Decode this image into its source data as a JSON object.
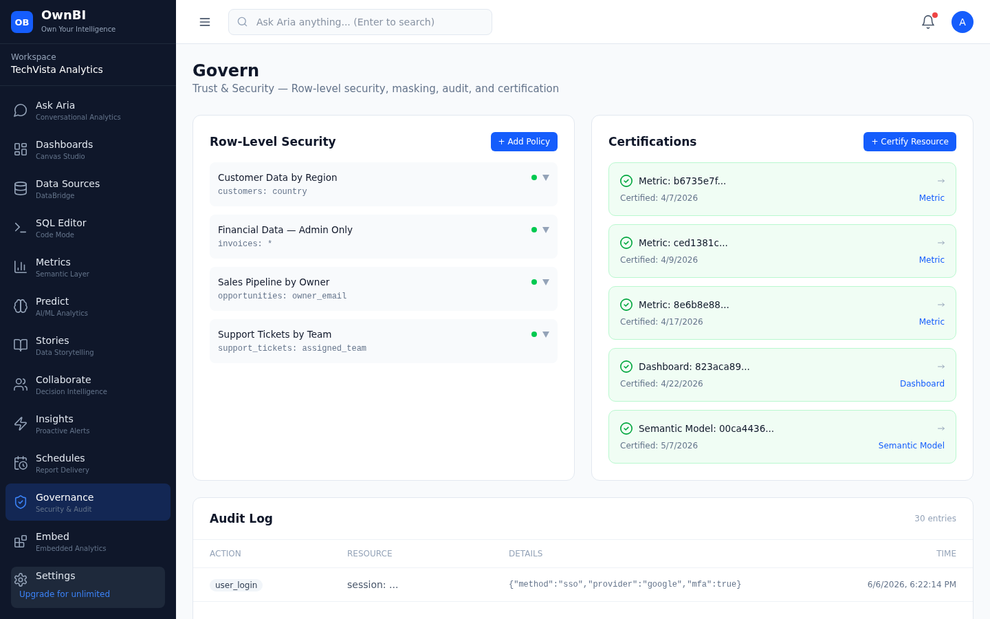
{
  "sidebar": {
    "brand": {
      "mark": "OB",
      "name": "OwnBI",
      "tagline": "Own Your Intelligence"
    },
    "workspace": {
      "label": "Workspace",
      "name": "TechVista Analytics"
    },
    "nav": [
      {
        "title": "Ask Aria",
        "subtitle": "Conversational Analytics",
        "selected": false
      },
      {
        "title": "Dashboards",
        "subtitle": "Canvas Studio",
        "selected": false
      },
      {
        "title": "Data Sources",
        "subtitle": "DataBridge",
        "selected": false
      },
      {
        "title": "SQL Editor",
        "subtitle": "Code Mode",
        "selected": false
      },
      {
        "title": "Metrics",
        "subtitle": "Semantic Layer",
        "selected": false
      },
      {
        "title": "Predict",
        "subtitle": "AI/ML Analytics",
        "selected": false
      },
      {
        "title": "Stories",
        "subtitle": "Data Storytelling",
        "selected": false
      },
      {
        "title": "Collaborate",
        "subtitle": "Decision Intelligence",
        "selected": false
      },
      {
        "title": "Insights",
        "subtitle": "Proactive Alerts",
        "selected": false
      },
      {
        "title": "Schedules",
        "subtitle": "Report Delivery",
        "selected": false
      },
      {
        "title": "Governance",
        "subtitle": "Security & Audit",
        "selected": true
      },
      {
        "title": "Embed",
        "subtitle": "Embedded Analytics",
        "selected": false
      }
    ],
    "footer": {
      "settings": {
        "title": "Settings",
        "selected": false
      },
      "upgrade_link": "Upgrade for unlimited"
    }
  },
  "topbar": {
    "search": {
      "placeholder": "Ask Aria anything... (Enter to search)"
    },
    "notifications": {
      "unread": true
    },
    "avatar": {
      "initial": "A"
    }
  },
  "page": {
    "title": "Govern",
    "subtitle": "Trust & Security — Row-level security, masking, audit, and certification"
  },
  "row_level_security": {
    "title": "Row-Level Security",
    "button": "+ Add Policy",
    "policies": [
      {
        "name": "Customer Data by Region",
        "rule": "customers: country",
        "enabled": true
      },
      {
        "name": "Financial Data — Admin Only",
        "rule": "invoices: *",
        "enabled": true
      },
      {
        "name": "Sales Pipeline by Owner",
        "rule": "opportunities: owner_email",
        "enabled": true
      },
      {
        "name": "Support Tickets by Team",
        "rule": "support_tickets: assigned_team",
        "enabled": true
      }
    ]
  },
  "certifications": {
    "title": "Certifications",
    "button": "+ Certify Resource",
    "items": [
      {
        "name": "Metric: b6735e7f...",
        "certified": "Certified: 4/7/2026",
        "type": "Metric"
      },
      {
        "name": "Metric: ced1381c...",
        "certified": "Certified: 4/9/2026",
        "type": "Metric"
      },
      {
        "name": "Metric: 8e6b8e88...",
        "certified": "Certified: 4/17/2026",
        "type": "Metric"
      },
      {
        "name": "Dashboard: 823aca89...",
        "certified": "Certified: 4/22/2026",
        "type": "Dashboard"
      },
      {
        "name": "Semantic Model: 00ca4436...",
        "certified": "Certified: 5/7/2026",
        "type": "Semantic Model"
      }
    ]
  },
  "audit_log": {
    "title": "Audit Log",
    "count": "30 entries",
    "columns": [
      "ACTION",
      "RESOURCE",
      "DETAILS",
      "TIME"
    ],
    "rows": [
      {
        "action": "user_login",
        "resource": "session: ...",
        "details": "{\"method\":\"sso\",\"provider\":\"google\",\"mfa\":true}",
        "time": "6/6/2026, 6:22:14 PM"
      }
    ]
  }
}
